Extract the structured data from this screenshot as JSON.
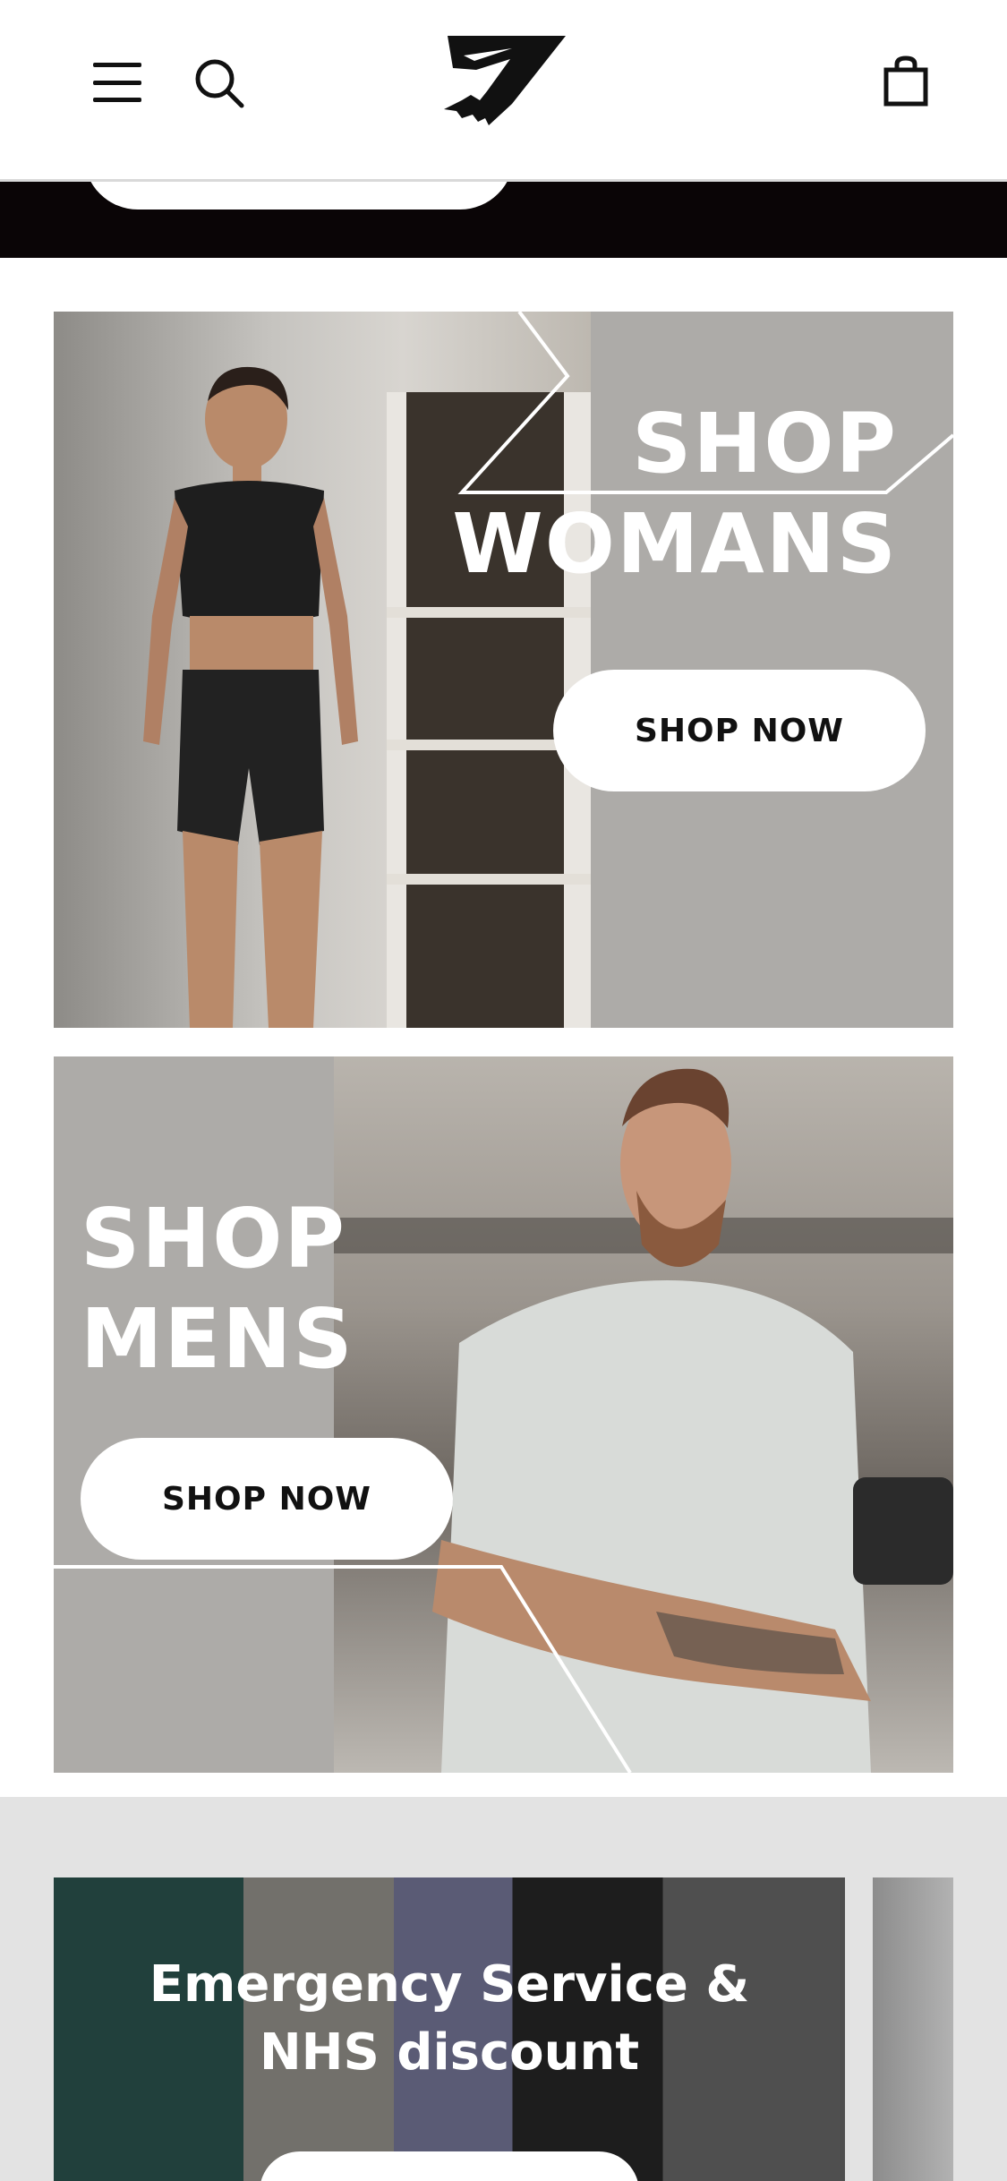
{
  "header": {
    "menu_icon": "hamburger-menu-icon",
    "search_icon": "search-icon",
    "logo_icon": "gymshark-logo",
    "bag_icon": "shopping-bag-icon"
  },
  "tiles": {
    "women": {
      "title_line1": "SHOP",
      "title_line2": "WOMANS",
      "button_label": "SHOP NOW"
    },
    "men": {
      "title_line1": "SHOP",
      "title_line2": "MENS",
      "button_label": "SHOP NOW"
    }
  },
  "discount_card": {
    "title_line1": "Emergency Service &",
    "title_line2": "NHS discount"
  },
  "colors": {
    "tile_grey": "#adaba8",
    "section_grey": "#e3e3e3",
    "band_black": "#0a0506"
  }
}
